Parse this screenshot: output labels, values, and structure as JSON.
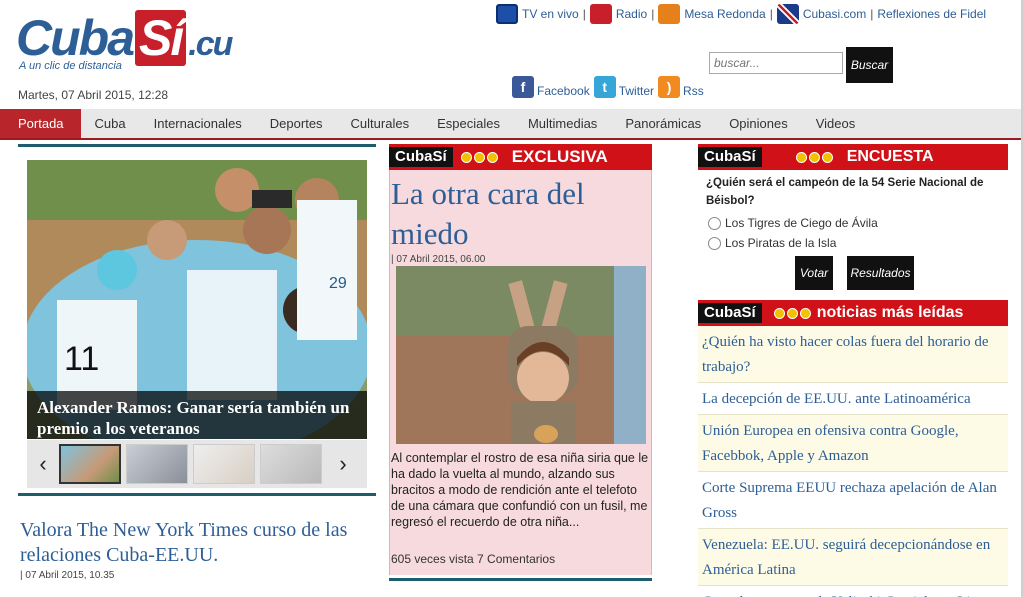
{
  "header": {
    "logo_cuba": "Cuba",
    "logo_si": "Sí",
    "logo_cu": ".cu",
    "tagline": "A un clic de distancia",
    "date": "Martes, 07 Abril 2015, 12:28"
  },
  "toplinks": {
    "tv": "TV en vivo",
    "radio": "Radio",
    "mesa": "Mesa Redonda",
    "cubasi_com": "Cubasi.com",
    "reflexiones": "Reflexiones de Fidel",
    "separator": "|"
  },
  "search": {
    "placeholder": "buscar...",
    "button": "Buscar"
  },
  "social": {
    "facebook": "Facebook",
    "twitter": "Twitter",
    "rss": "Rss"
  },
  "nav": {
    "items": [
      "Portada",
      "Cuba",
      "Internacionales",
      "Deportes",
      "Culturales",
      "Especiales",
      "Multimedias",
      "Panorámicas",
      "Opiniones",
      "Videos"
    ]
  },
  "hero": {
    "caption": "Alexander Ramos: Ganar sería también un premio a los veteranos",
    "prev": "‹",
    "next": "›"
  },
  "news2": {
    "title": "Valora The New York Times curso de las relaciones Cuba-EE.UU.",
    "date": "| 07 Abril 2015, 10.35"
  },
  "exclusiva": {
    "brand": "CubaSí",
    "label": "EXCLUSIVA",
    "title": "La otra cara del miedo",
    "date": "| 07 Abril 2015, 06.00",
    "text": "Al contemplar el rostro de esa niña siria que le ha dado la vuelta al mundo, alzando sus bracitos a modo de rendición ante el telefoto de una cámara que confundió con un fusil, me regresó el recuerdo de otra niña...",
    "meta": "605 veces vista 7 Comentarios"
  },
  "encuesta": {
    "brand": "CubaSí",
    "label": "ENCUESTA",
    "question": "¿Quién será el campeón de la 54 Serie Nacional de Béisbol?",
    "options": [
      "Los Tigres de Ciego de Ávila",
      "Los Piratas de la Isla"
    ],
    "vote": "Votar",
    "results": "Resultados"
  },
  "most_read": {
    "brand": "CubaSí",
    "label": "noticias más leídas",
    "items": [
      "¿Quién ha visto hacer colas fuera del horario de trabajo?",
      "La decepción de EE.UU. ante Latinoamérica",
      "Unión Europea en ofensiva contra Google, Facebbok, Apple y Amazon",
      "Corte Suprema EEUU rechaza apelación de Alan Gross",
      "Venezuela: EE.UU. seguirá decepcionándose en América Latina",
      "Cancelan contrato de Yulieski Gurriel con Liga"
    ]
  },
  "colors": {
    "brand_blue": "#2d5e96",
    "brand_red": "#d01218",
    "nav_active": "#b8262c",
    "teal_rule": "#1f5c6e"
  }
}
